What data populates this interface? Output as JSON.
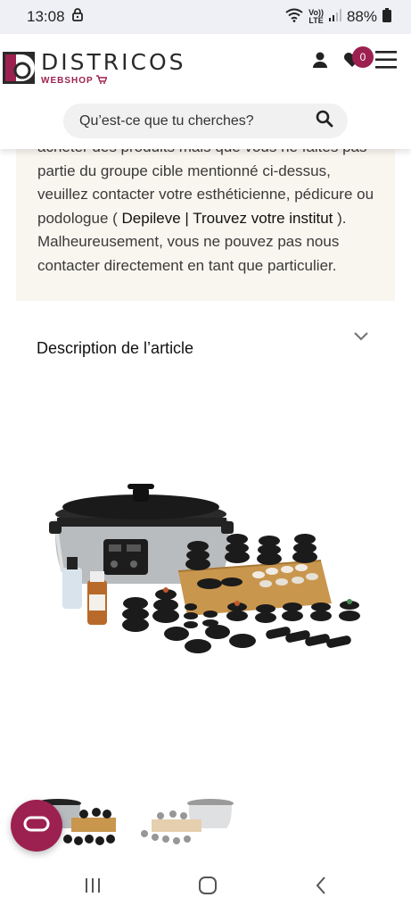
{
  "status": {
    "time": "13:08",
    "battery": "88%",
    "volte_top": "Vo))",
    "volte_bottom": "LTE"
  },
  "brand": {
    "name": "DISTRICOS",
    "sub": "WEBSHOP",
    "color": "#9c2150"
  },
  "header": {
    "wishlist_count": "0"
  },
  "search": {
    "placeholder": "Qu’est-ce que tu cherches?"
  },
  "info": {
    "line_partial": "acheter des produits mais que vous ne faites pas",
    "line2": "partie du groupe cible mentionné ci-dessus,",
    "line3": "veuillez contacter votre esthéticienne, pédicure ou",
    "line4_prefix": "podologue ( ",
    "link": "Depileve | Trouvez votre institut",
    "line4_suffix": " ).",
    "line5": "Malheureusement, vous ne pouvez pas nous",
    "line6": "contacter directement en tant que particulier."
  },
  "description": {
    "heading": "Description de l’article"
  },
  "icons": [
    "lock-icon",
    "wifi-icon",
    "signal-icon",
    "battery-icon",
    "user-icon",
    "heart-icon",
    "menu-icon",
    "search-icon",
    "chevron-down-icon",
    "chat-icon",
    "recent-apps-icon",
    "home-icon",
    "back-icon"
  ]
}
